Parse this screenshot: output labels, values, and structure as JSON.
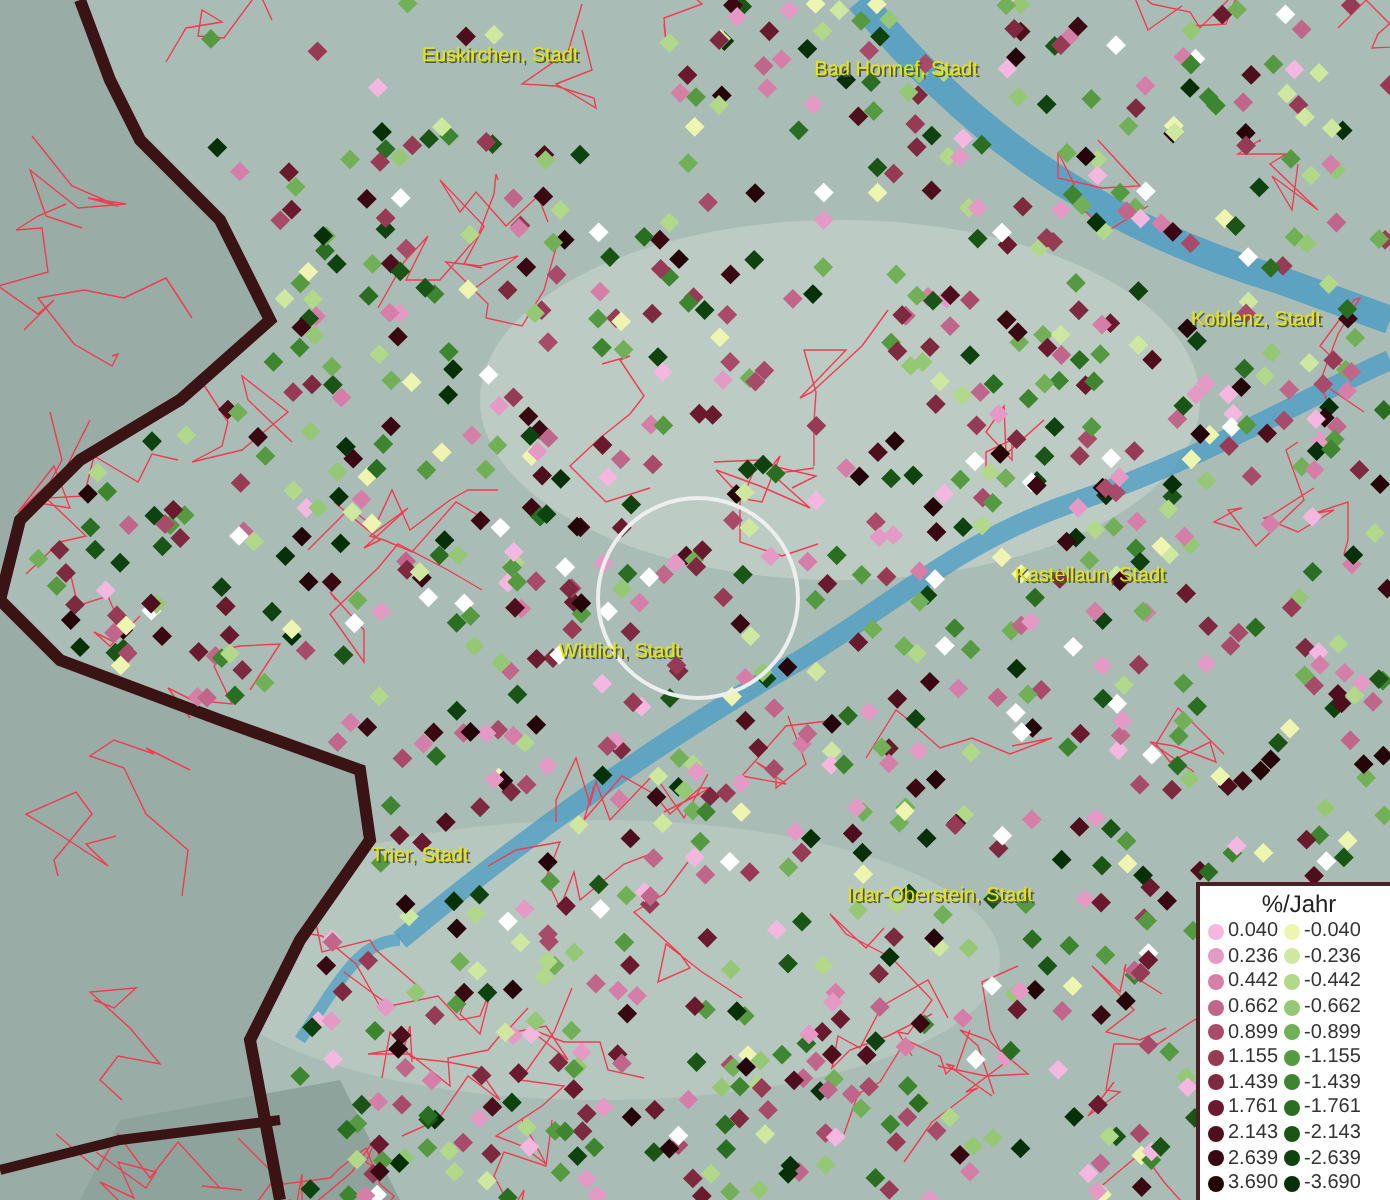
{
  "map": {
    "places": [
      {
        "label": "Euskirchen, Stadt"
      },
      {
        "label": "Bad Honnef, Stadt"
      },
      {
        "label": "Koblenz, Stadt"
      },
      {
        "label": "Kastellaun, Stadt"
      },
      {
        "label": "Wittlich, Stadt"
      },
      {
        "label": "Trier, Stadt"
      },
      {
        "label": "Idar-Oberstein, Stadt"
      }
    ]
  },
  "legend": {
    "title": "%/Jahr",
    "positive": [
      {
        "label": "0.040",
        "color": "#f4b8e0"
      },
      {
        "label": "0.236",
        "color": "#e49ac4"
      },
      {
        "label": "0.442",
        "color": "#d47ea8"
      },
      {
        "label": "0.662",
        "color": "#c0668a"
      },
      {
        "label": "0.899",
        "color": "#a84a6a"
      },
      {
        "label": "1.155",
        "color": "#963a55"
      },
      {
        "label": "1.439",
        "color": "#7d2a40"
      },
      {
        "label": "1.761",
        "color": "#6a1a2e"
      },
      {
        "label": "2.143",
        "color": "#4f0e1e"
      },
      {
        "label": "2.639",
        "color": "#3a0812"
      },
      {
        "label": "3.690",
        "color": "#25040a"
      }
    ],
    "negative": [
      {
        "label": "-0.040",
        "color": "#eef5b0"
      },
      {
        "label": "-0.236",
        "color": "#cfe8a0"
      },
      {
        "label": "-0.442",
        "color": "#b2d88a"
      },
      {
        "label": "-0.662",
        "color": "#94c874"
      },
      {
        "label": "-0.899",
        "color": "#72b058"
      },
      {
        "label": "-1.155",
        "color": "#559a40"
      },
      {
        "label": "-1.439",
        "color": "#3e8530"
      },
      {
        "label": "-1.761",
        "color": "#2a6e22"
      },
      {
        "label": "-2.143",
        "color": "#1a5516"
      },
      {
        "label": "-2.639",
        "color": "#0e420e"
      },
      {
        "label": "-3.690",
        "color": "#063008"
      }
    ]
  }
}
